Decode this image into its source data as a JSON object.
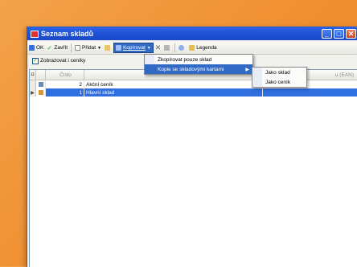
{
  "window": {
    "title": "Seznam skladů"
  },
  "toolbar": {
    "ok": "OK",
    "close": "Zavřít",
    "add": "Přidat",
    "copy": "Kopírovat",
    "legend": "Legenda"
  },
  "options": {
    "show_pricelists_label": "Zobrazovat i ceníky",
    "show_pricelists_checked": true
  },
  "grid": {
    "columns": {
      "code": "Číslo",
      "ean": "u (EAN)"
    },
    "rows": [
      {
        "number": "2",
        "name": "Akční ceník",
        "selected": false
      },
      {
        "number": "1",
        "name": "Hlavní sklad",
        "selected": true
      }
    ]
  },
  "copy_menu": {
    "items": [
      {
        "label": "Zkopírovat pouze sklad",
        "submenu": false
      },
      {
        "label": "Kopie se skladovými kartami",
        "submenu": true
      }
    ]
  },
  "sub_menu": {
    "items": [
      {
        "label": "Jako sklad"
      },
      {
        "label": "Jako ceník"
      }
    ]
  },
  "colors": {
    "titlebar": "#1f53d6",
    "selection": "#316ac5",
    "background": "#ef8e2f"
  }
}
